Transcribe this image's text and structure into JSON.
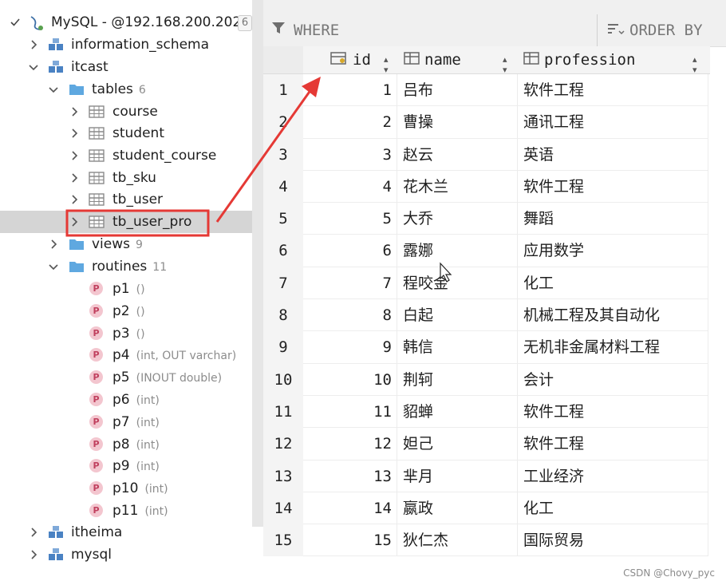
{
  "tree": {
    "connection": {
      "label": "MySQL - @192.168.200.202",
      "badge": "6"
    },
    "schemas": {
      "information_schema": "information_schema",
      "itcast": "itcast",
      "itheima": "itheima",
      "mysql": "mysql"
    },
    "tables_folder": {
      "label": "tables",
      "count": "6"
    },
    "tables": [
      "course",
      "student",
      "student_course",
      "tb_sku",
      "tb_user",
      "tb_user_pro"
    ],
    "views_folder": {
      "label": "views",
      "count": "9"
    },
    "routines_folder": {
      "label": "routines",
      "count": "11"
    },
    "routines": [
      {
        "name": "p1",
        "sig": "()"
      },
      {
        "name": "p2",
        "sig": "()"
      },
      {
        "name": "p3",
        "sig": "()"
      },
      {
        "name": "p4",
        "sig": "(int, OUT varchar)"
      },
      {
        "name": "p5",
        "sig": "(INOUT double)"
      },
      {
        "name": "p6",
        "sig": "(int)"
      },
      {
        "name": "p7",
        "sig": "(int)"
      },
      {
        "name": "p8",
        "sig": "(int)"
      },
      {
        "name": "p9",
        "sig": "(int)"
      },
      {
        "name": "p10",
        "sig": "(int)"
      },
      {
        "name": "p11",
        "sig": "(int)"
      }
    ],
    "routine_icon_letter": "P"
  },
  "filter": {
    "where": "WHERE",
    "order_by": "ORDER BY"
  },
  "grid": {
    "columns": [
      "id",
      "name",
      "profession"
    ],
    "rows": [
      {
        "n": "1",
        "id": "1",
        "name": "吕布",
        "profession": "软件工程"
      },
      {
        "n": "2",
        "id": "2",
        "name": "曹操",
        "profession": "通讯工程"
      },
      {
        "n": "3",
        "id": "3",
        "name": "赵云",
        "profession": "英语"
      },
      {
        "n": "4",
        "id": "4",
        "name": "花木兰",
        "profession": "软件工程"
      },
      {
        "n": "5",
        "id": "5",
        "name": "大乔",
        "profession": "舞蹈"
      },
      {
        "n": "6",
        "id": "6",
        "name": "露娜",
        "profession": "应用数学"
      },
      {
        "n": "7",
        "id": "7",
        "name": "程咬金",
        "profession": "化工"
      },
      {
        "n": "8",
        "id": "8",
        "name": "白起",
        "profession": "机械工程及其自动化"
      },
      {
        "n": "9",
        "id": "9",
        "name": "韩信",
        "profession": "无机非金属材料工程"
      },
      {
        "n": "10",
        "id": "10",
        "name": "荆轲",
        "profession": "会计"
      },
      {
        "n": "11",
        "id": "11",
        "name": "貂蝉",
        "profession": "软件工程"
      },
      {
        "n": "12",
        "id": "12",
        "name": "妲己",
        "profession": "软件工程"
      },
      {
        "n": "13",
        "id": "13",
        "name": "芈月",
        "profession": "工业经济"
      },
      {
        "n": "14",
        "id": "14",
        "name": "嬴政",
        "profession": "化工"
      },
      {
        "n": "15",
        "id": "15",
        "name": "狄仁杰",
        "profession": "国际贸易"
      }
    ]
  },
  "colors": {
    "highlight_box": "#e53935",
    "arrow": "#e53935",
    "selected_row": "#d5d5d5"
  },
  "watermark": "CSDN @Chovy_pyc"
}
